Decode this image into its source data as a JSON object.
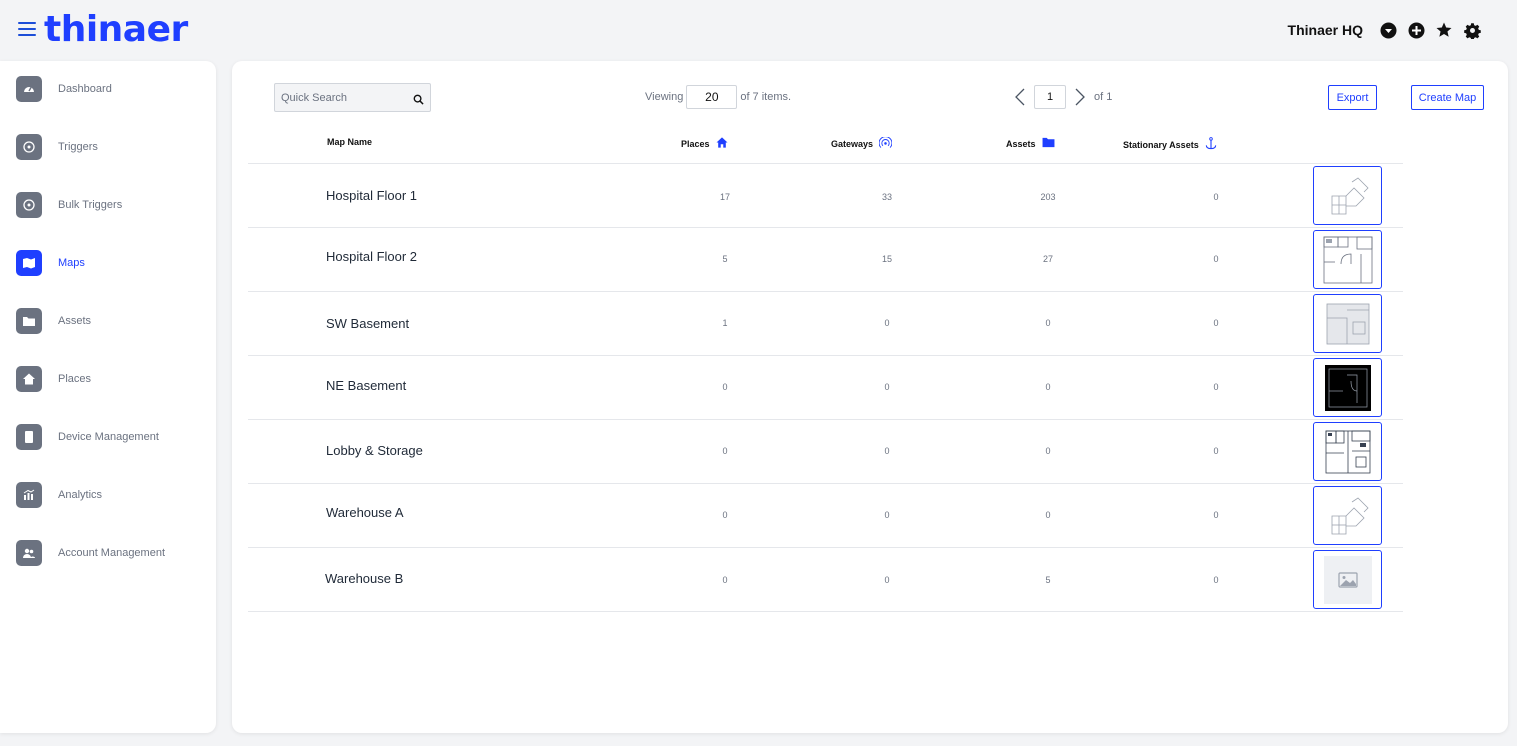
{
  "header": {
    "logo": "thinaer",
    "org_name": "Thinaer HQ",
    "icons": [
      "caret-circle-icon",
      "plus-circle-icon",
      "star-icon",
      "gear-icon"
    ]
  },
  "sidebar": {
    "items": [
      {
        "label": "Dashboard",
        "icon": "dashboard-icon",
        "active": false
      },
      {
        "label": "Triggers",
        "icon": "crosshair-icon",
        "active": false
      },
      {
        "label": "Bulk Triggers",
        "icon": "crosshair-icon",
        "active": false
      },
      {
        "label": "Maps",
        "icon": "map-icon",
        "active": true
      },
      {
        "label": "Assets",
        "icon": "folder-icon",
        "active": false
      },
      {
        "label": "Places",
        "icon": "home-icon",
        "active": false
      },
      {
        "label": "Device Management",
        "icon": "device-icon",
        "active": false
      },
      {
        "label": "Analytics",
        "icon": "analytics-icon",
        "active": false
      },
      {
        "label": "Account Management",
        "icon": "users-icon",
        "active": false
      }
    ]
  },
  "toolbar": {
    "search_placeholder": "Quick Search",
    "viewing_label": "Viewing",
    "viewing_value": "20",
    "viewing_suffix": "of 7 items.",
    "page_value": "1",
    "page_suffix": "of 1",
    "export_label": "Export",
    "create_label": "Create Map"
  },
  "table": {
    "columns": [
      "Map Name",
      "Places",
      "Gateways",
      "Assets",
      "Stationary Assets"
    ],
    "rows": [
      {
        "name": "Hospital Floor 1",
        "places": "17",
        "gateways": "33",
        "assets": "203",
        "stationary": "0",
        "thumb": "floorplan-light"
      },
      {
        "name": "Hospital Floor 2",
        "places": "5",
        "gateways": "15",
        "assets": "27",
        "stationary": "0",
        "thumb": "floorplan-detailed"
      },
      {
        "name": "SW Basement",
        "places": "1",
        "gateways": "0",
        "assets": "0",
        "stationary": "0",
        "thumb": "floorplan-gray"
      },
      {
        "name": "NE Basement",
        "places": "0",
        "gateways": "0",
        "assets": "0",
        "stationary": "0",
        "thumb": "floorplan-dark"
      },
      {
        "name": "Lobby & Storage",
        "places": "0",
        "gateways": "0",
        "assets": "0",
        "stationary": "0",
        "thumb": "floorplan-dense"
      },
      {
        "name": "Warehouse A",
        "places": "0",
        "gateways": "0",
        "assets": "0",
        "stationary": "0",
        "thumb": "floorplan-light"
      },
      {
        "name": "Warehouse B",
        "places": "0",
        "gateways": "0",
        "assets": "5",
        "stationary": "0",
        "thumb": "image-placeholder"
      }
    ]
  },
  "colors": {
    "brand": "#1f3fff",
    "nav_inactive": "#6b7280",
    "background": "#f3f4f6"
  }
}
